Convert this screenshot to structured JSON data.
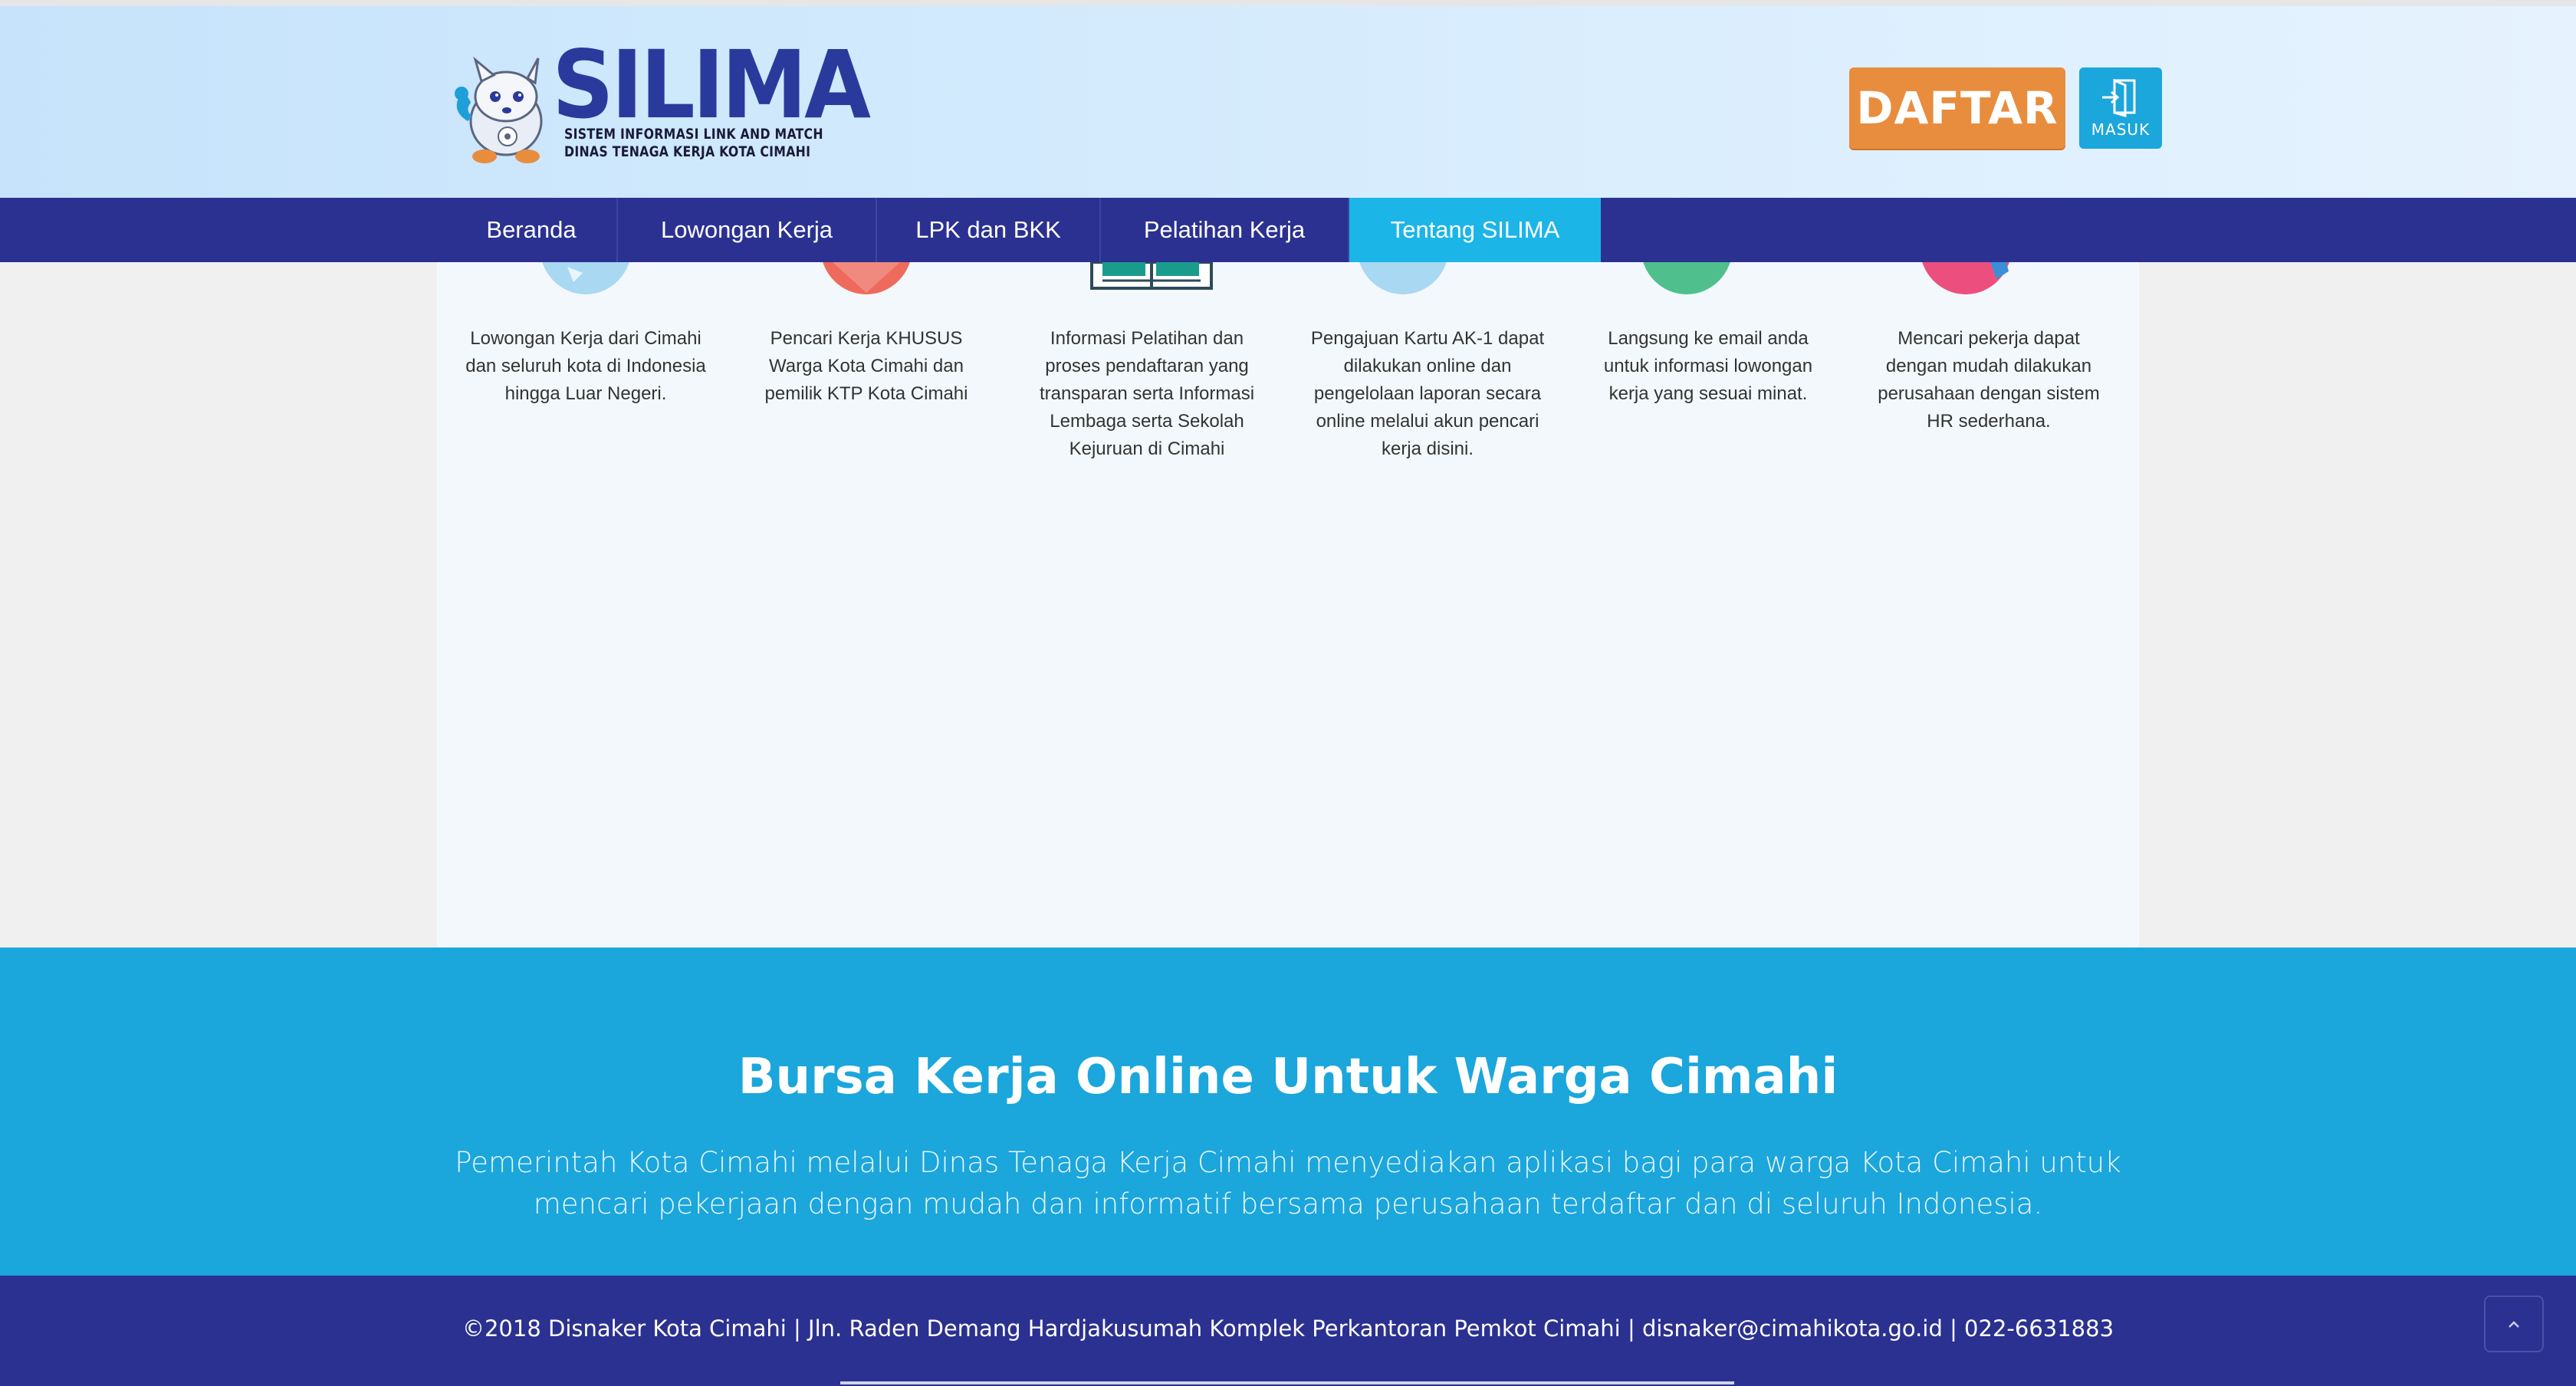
{
  "header": {
    "logo_text": "SILIMA",
    "logo_subtitle_1": "SISTEM INFORMASI LINK AND MATCH",
    "logo_subtitle_2": "DINAS TENAGA KERJA KOTA CIMAHI",
    "register_label": "DAFTAR",
    "login_label": "MASUK",
    "login_icon": "door-enter-icon"
  },
  "nav": {
    "items": [
      {
        "label": "Beranda"
      },
      {
        "label": "Lowongan Kerja"
      },
      {
        "label": "LPK dan BKK"
      },
      {
        "label": "Pelatihan Kerja"
      },
      {
        "label": "Tentang SILIMA",
        "active": true
      }
    ]
  },
  "features": [
    {
      "icon": "chat-bubble-icon",
      "text": "Lowongan Kerja dari Cimahi dan seluruh kota di Indonesia hingga Luar Negeri."
    },
    {
      "icon": "location-pin-icon",
      "text": "Pencari Kerja KHUSUS Warga Kota Cimahi dan pemilik KTP Kota Cimahi"
    },
    {
      "icon": "open-book-icon",
      "text": "Informasi Pelatihan dan proses pendaftaran yang transparan serta Informasi Lembaga serta Sekolah Kejuruan di Cimahi"
    },
    {
      "icon": "id-card-icon",
      "text": "Pengajuan Kartu AK-1 dapat dilakukan online dan pengelolaan laporan secara online melalui akun pencari kerja disini."
    },
    {
      "icon": "email-icon",
      "text": "Langsung ke email anda untuk informasi lowongan kerja yang sesuai minat."
    },
    {
      "icon": "search-people-icon",
      "text": "Mencari pekerja dapat dengan mudah dilakukan perusahaan dengan sistem HR sederhana."
    }
  ],
  "banner": {
    "title": "Bursa Kerja Online Untuk Warga Cimahi",
    "text": "Pemerintah Kota Cimahi melalui Dinas Tenaga Kerja Cimahi menyediakan aplikasi bagi para warga Kota Cimahi untuk mencari pekerjaan dengan mudah dan informatif bersama perusahaan terdaftar dan di seluruh Indonesia."
  },
  "footer": {
    "text": "©2018 Disnaker Kota Cimahi | Jln. Raden Demang Hardjakusumah Komplek Perkantoran Pemkot Cimahi | disnaker@cimahikota.go.id | 022-6631883",
    "back_to_top_icon": "chevron-up-icon"
  },
  "colors": {
    "nav_bg": "#2b3190",
    "nav_active": "#1cb5e8",
    "register_btn": "#e88d3e",
    "login_btn": "#1ba6dc",
    "banner_bg": "#1ba6dc"
  }
}
